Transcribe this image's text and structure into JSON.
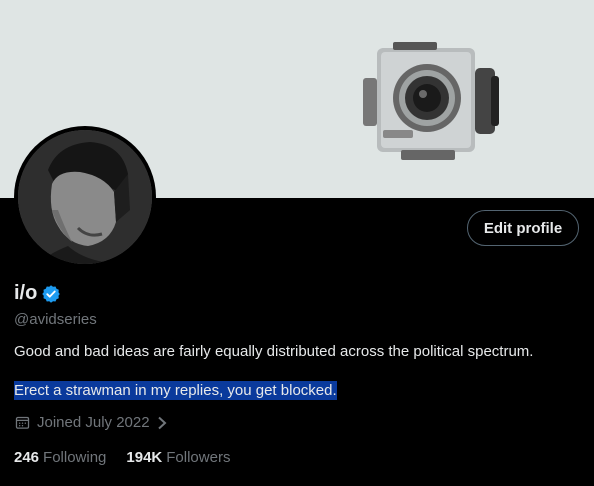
{
  "profile": {
    "name": "i/o",
    "handle": "@avidseries",
    "bio_line1": "Good and bad ideas are fairly equally distributed across the political spectrum.",
    "bio_line2": "Erect a strawman in my replies, you get blocked.",
    "joined": "Joined July 2022",
    "verified_color": "#1d9bf0"
  },
  "actions": {
    "edit_profile_label": "Edit profile"
  },
  "stats": {
    "following_count": "246",
    "following_label": "Following",
    "followers_count": "194K",
    "followers_label": "Followers"
  },
  "icons": {
    "verified": "verified-badge-icon",
    "calendar": "calendar-icon",
    "chevron": "chevron-right-icon"
  }
}
